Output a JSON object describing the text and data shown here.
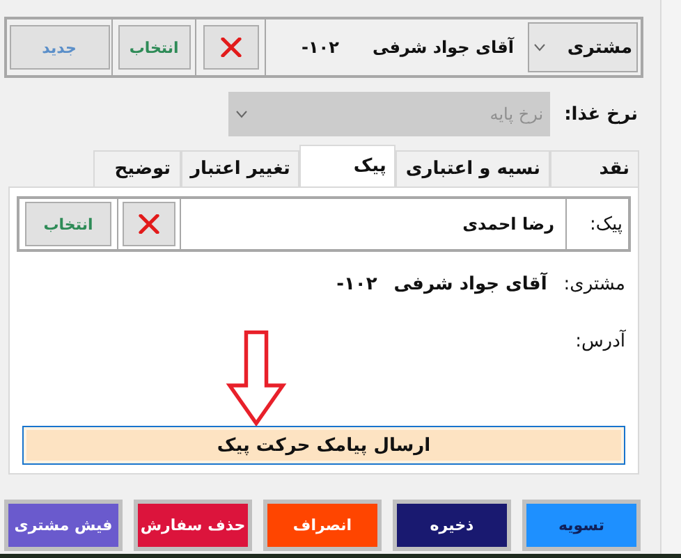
{
  "customer_bar": {
    "type_dropdown": "مشتری",
    "customer_name": "آقای جواد شرفی",
    "customer_code": "-۱۰۲",
    "select_button": "انتخاب",
    "new_button": "جدید"
  },
  "food_rate": {
    "label": "نرخ غذا:",
    "value": "نرخ پایه",
    "disabled": true
  },
  "tabs": [
    {
      "label": "نقد",
      "selected": false
    },
    {
      "label": "نسیه و اعتباری",
      "selected": false
    },
    {
      "label": "پیک",
      "selected": true
    },
    {
      "label": "تغییر اعتبار",
      "selected": false
    },
    {
      "label": "توضیح",
      "selected": false
    }
  ],
  "courier_panel": {
    "courier_label": "پیک:",
    "courier_name": "رضا احمدی",
    "select_button": "انتخاب",
    "customer_label": "مشتری:",
    "customer_name": "آقای جواد شرفی",
    "customer_code": "-۱۰۲",
    "address_label": "آدرس:",
    "send_sms_button": "ارسال پیامک حرکت پیک"
  },
  "actions": [
    {
      "label": "تسویه",
      "color": "#1e90ff"
    },
    {
      "label": "ذخیره",
      "color": "#191970"
    },
    {
      "label": "انصراف",
      "color": "#ff4500"
    },
    {
      "label": "حذف سفارش",
      "color": "#dc143c"
    },
    {
      "label": "فیش مشتری",
      "color": "#6a5acd"
    }
  ]
}
